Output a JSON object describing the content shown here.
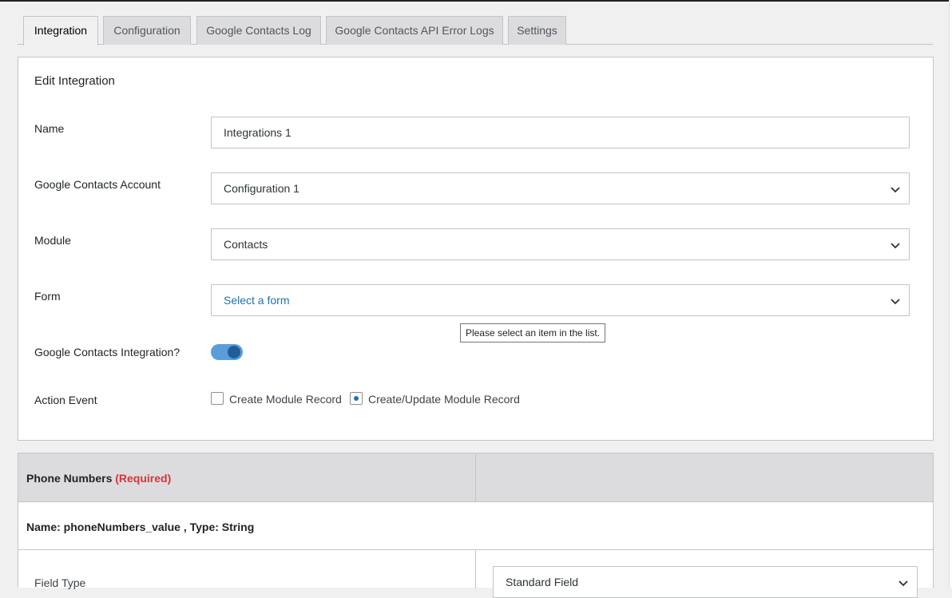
{
  "tabs": [
    {
      "label": "Integration",
      "active": true
    },
    {
      "label": "Configuration",
      "active": false
    },
    {
      "label": "Google Contacts Log",
      "active": false
    },
    {
      "label": "Google Contacts API Error Logs",
      "active": false
    },
    {
      "label": "Settings",
      "active": false
    }
  ],
  "edit": {
    "title": "Edit Integration",
    "name_label": "Name",
    "name_value": "Integrations 1",
    "account_label": "Google Contacts Account",
    "account_value": "Configuration 1",
    "module_label": "Module",
    "module_value": "Contacts",
    "form_label": "Form",
    "form_value": "Select a form",
    "form_tooltip": "Please select an item in the list.",
    "integration_label": "Google Contacts Integration?",
    "integration_enabled": true,
    "action_label": "Action Event",
    "action_options": [
      {
        "label": "Create Module Record",
        "checked": false
      },
      {
        "label": "Create/Update Module Record",
        "checked": true
      }
    ]
  },
  "mapping": {
    "field_title": "Phone Numbers",
    "required_text": "(Required)",
    "field_meta": "Name: phoneNumbers_value , Type: String",
    "field_type_label": "Field Type",
    "field_type_value": "Standard Field"
  },
  "colors": {
    "accent": "#2271b1",
    "toggle_on": "#5b9dd9",
    "required": "#d63638"
  }
}
